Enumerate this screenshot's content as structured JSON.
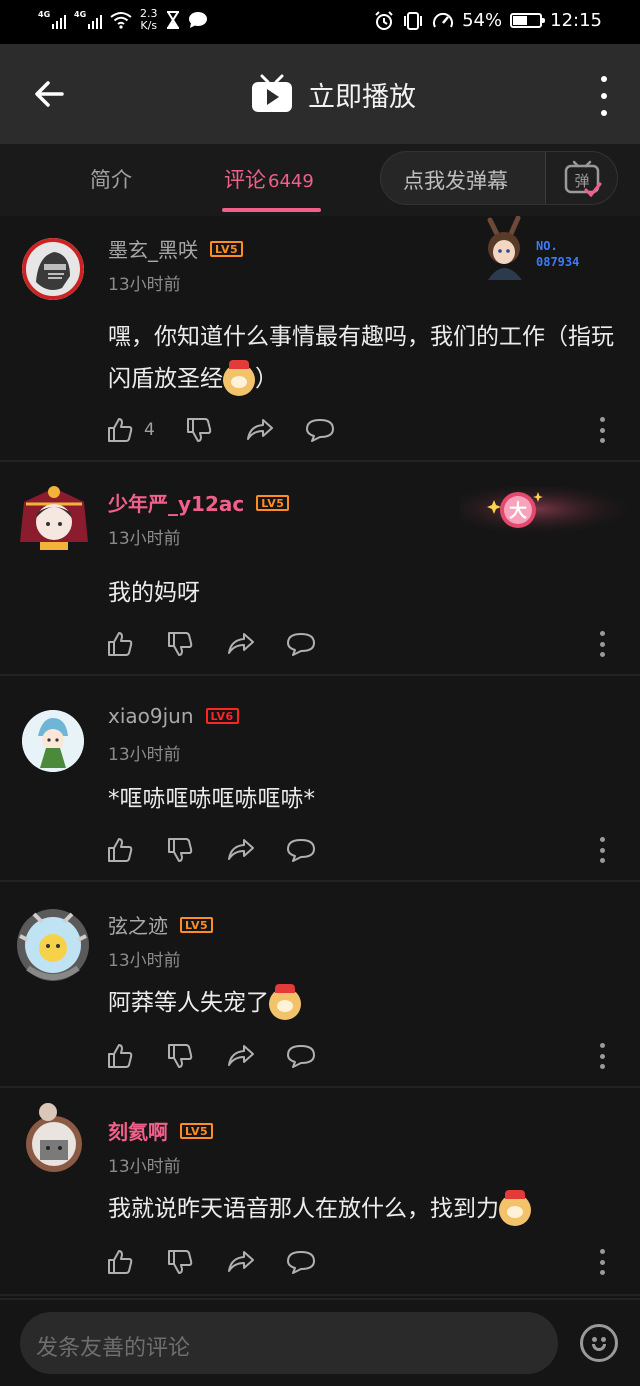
{
  "status_bar": {
    "net1": "4G",
    "net2": "4G",
    "speed_value": "2.3",
    "speed_unit": "K/s",
    "battery_text": "54%",
    "battery_level": 0.54,
    "time": "12:15"
  },
  "header": {
    "title": "立即播放"
  },
  "tabs": [
    {
      "label": "简介"
    },
    {
      "label": "评论",
      "count": "6449"
    }
  ],
  "danmaku_button": {
    "label": "点我发弹幕",
    "icon_text": "弹"
  },
  "comments": [
    {
      "username": "墨玄_黑咲",
      "level": "LV5",
      "time": "13小时前",
      "text": "嘿，你知道什么事情最有趣吗，我们的工作（指玩闪盾放圣经",
      "text_tail": "）",
      "has_emoji": true,
      "likes": "4",
      "badge_label": "NO.",
      "badge_number": "087934"
    },
    {
      "username": "少年严_y12ac",
      "level": "LV5",
      "time": "13小时前",
      "text": "我的妈呀",
      "badge_char": "大"
    },
    {
      "username": "xiao9jun",
      "level": "LV6",
      "time": "13小时前",
      "text": "*哐哧哐哧哐哧哐哧*"
    },
    {
      "username": "弦之迹",
      "level": "LV5",
      "time": "13小时前",
      "text": "阿莽等人失宠了",
      "has_emoji": true
    },
    {
      "username": "刻氦啊",
      "level": "LV5",
      "time": "13小时前",
      "text": "我就说昨天语音那人在放什么，找到力",
      "has_emoji": true
    }
  ],
  "bottom_bar": {
    "placeholder": "发条友善的评论"
  },
  "icons": [
    "back-arrow-icon",
    "tv-play-icon",
    "more-vertical-icon",
    "like-icon",
    "dislike-icon",
    "share-icon",
    "reply-icon",
    "emoji-icon",
    "danmaku-icon"
  ],
  "colors": {
    "accent_pink": "#f0608a",
    "level5": "#ff8c24",
    "level6": "#ff2424",
    "badge_blue": "#3a7bff"
  }
}
